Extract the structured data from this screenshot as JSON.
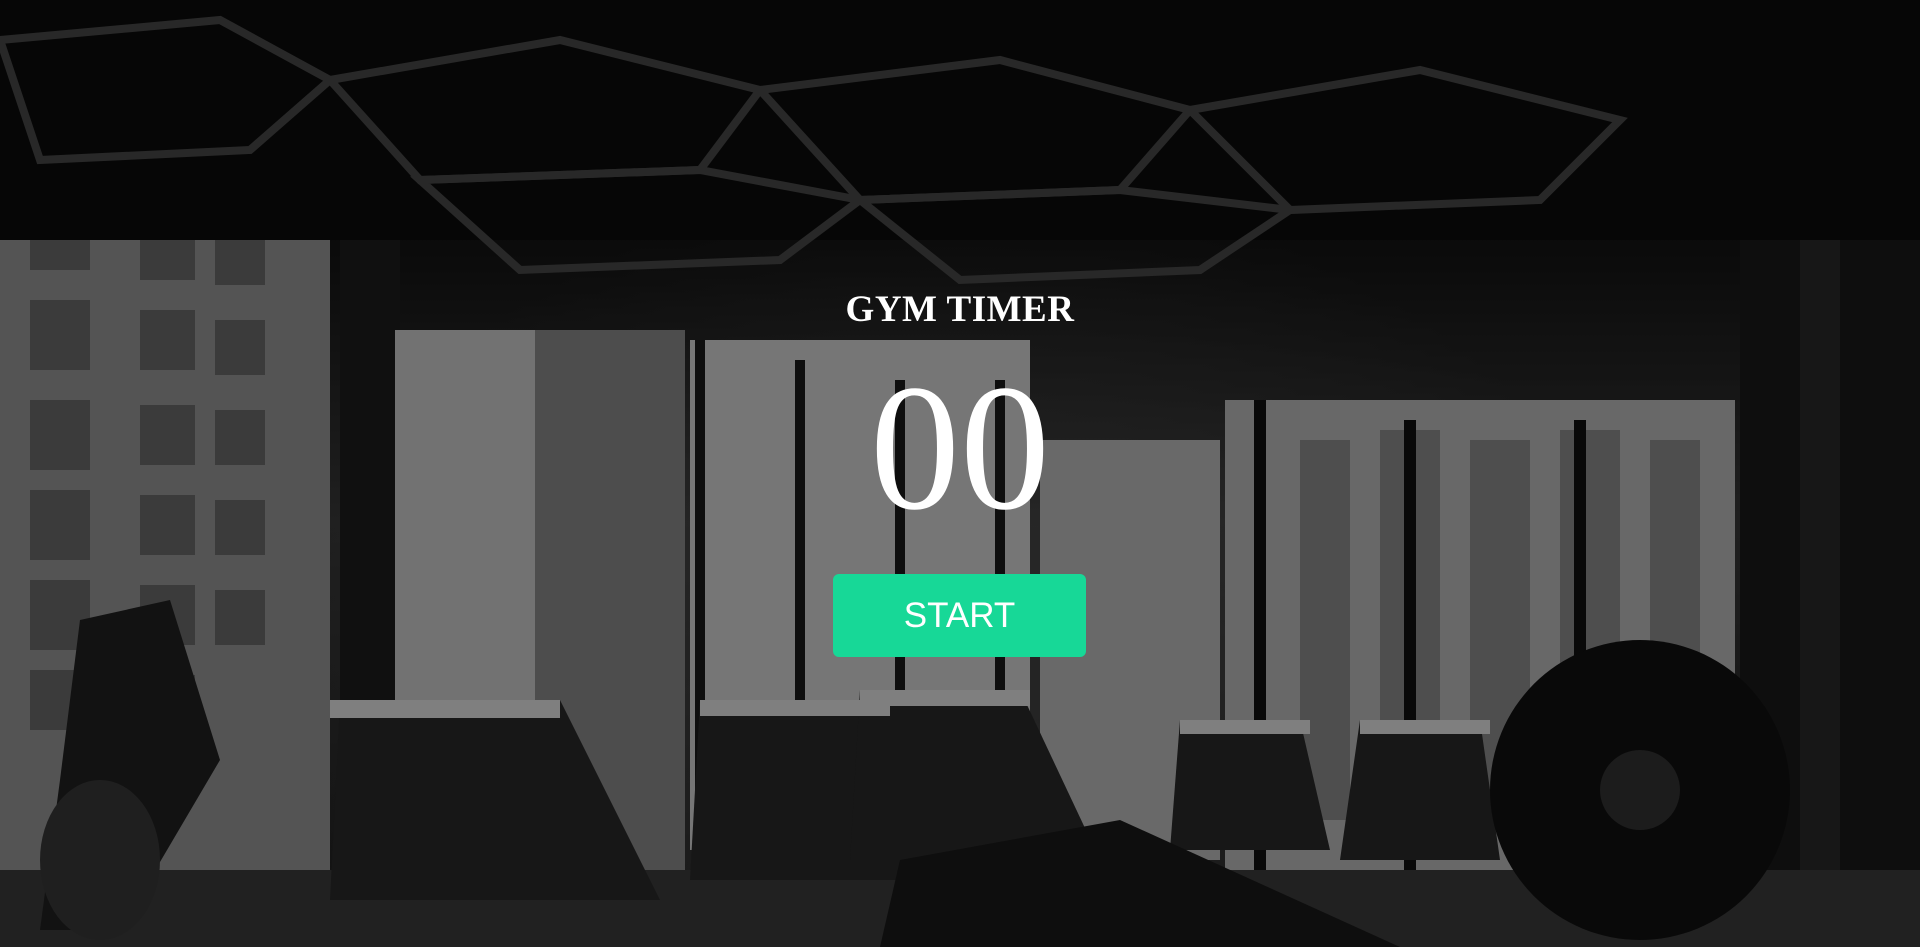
{
  "page": {
    "title": "GYM TIMER"
  },
  "timer": {
    "value": "00"
  },
  "controls": {
    "start_label": "START"
  },
  "colors": {
    "accent": "#17d897",
    "text": "#ffffff"
  },
  "background": {
    "image_subject": "gym-interior-photo"
  }
}
